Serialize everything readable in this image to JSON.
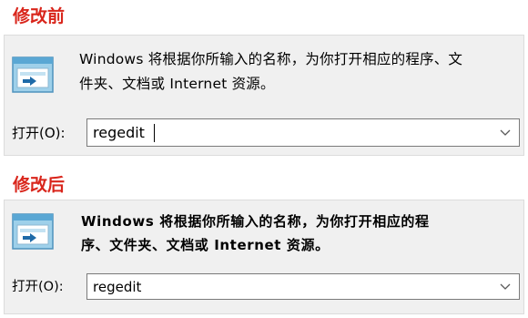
{
  "before": {
    "label": "修改前",
    "description_line1": "Windows 将根据你所输入的名称，为你打开相应的程序、文",
    "description_line2": "件夹、文档或 Internet 资源。",
    "open_label": "打开(O):",
    "command_value": "regedit"
  },
  "after": {
    "label": "修改后",
    "description_line1": "Windows 将根据你所输入的名称，为你打开相应的程",
    "description_line2": "序、文件夹、文档或 Internet 资源。",
    "open_label": "打开(O):",
    "command_value": "regedit"
  },
  "icons": {
    "run": "run-dialog-icon",
    "dropdown": "chevron-down-icon"
  },
  "colors": {
    "section_label": "#d9261c",
    "dialog_background": "#f0f0f0",
    "input_border": "#7a7a7a"
  }
}
